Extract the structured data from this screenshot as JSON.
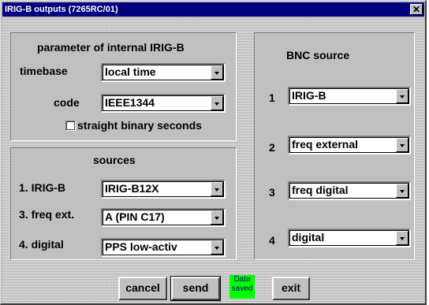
{
  "window": {
    "title": "IRIG-B outputs (7265RC/01)"
  },
  "internal": {
    "title": "parameter of internal IRIG-B",
    "timebase_label": "timebase",
    "timebase_value": "local time",
    "code_label": "code",
    "code_value": "IEEE1344",
    "sbs_label": "straight binary seconds",
    "sbs_checked": false
  },
  "sources": {
    "title": "sources",
    "irigb_label": "1. IRIG-B",
    "irigb_value": "IRIG-B12X",
    "freq_label": "3. freq ext.",
    "freq_value": "A (PIN C17)",
    "digital_label": "4. digital",
    "digital_value": "PPS low-activ"
  },
  "bnc": {
    "title": "BNC source",
    "rows": [
      {
        "num": "1",
        "value": "IRIG-B"
      },
      {
        "num": "2",
        "value": "freq external"
      },
      {
        "num": "3",
        "value": "freq digital"
      },
      {
        "num": "4",
        "value": "digital"
      }
    ]
  },
  "buttons": {
    "cancel": "cancel",
    "send": "send",
    "exit": "exit"
  },
  "status": {
    "line1": "Data",
    "line2": "saved",
    "color": "#00ff00"
  }
}
